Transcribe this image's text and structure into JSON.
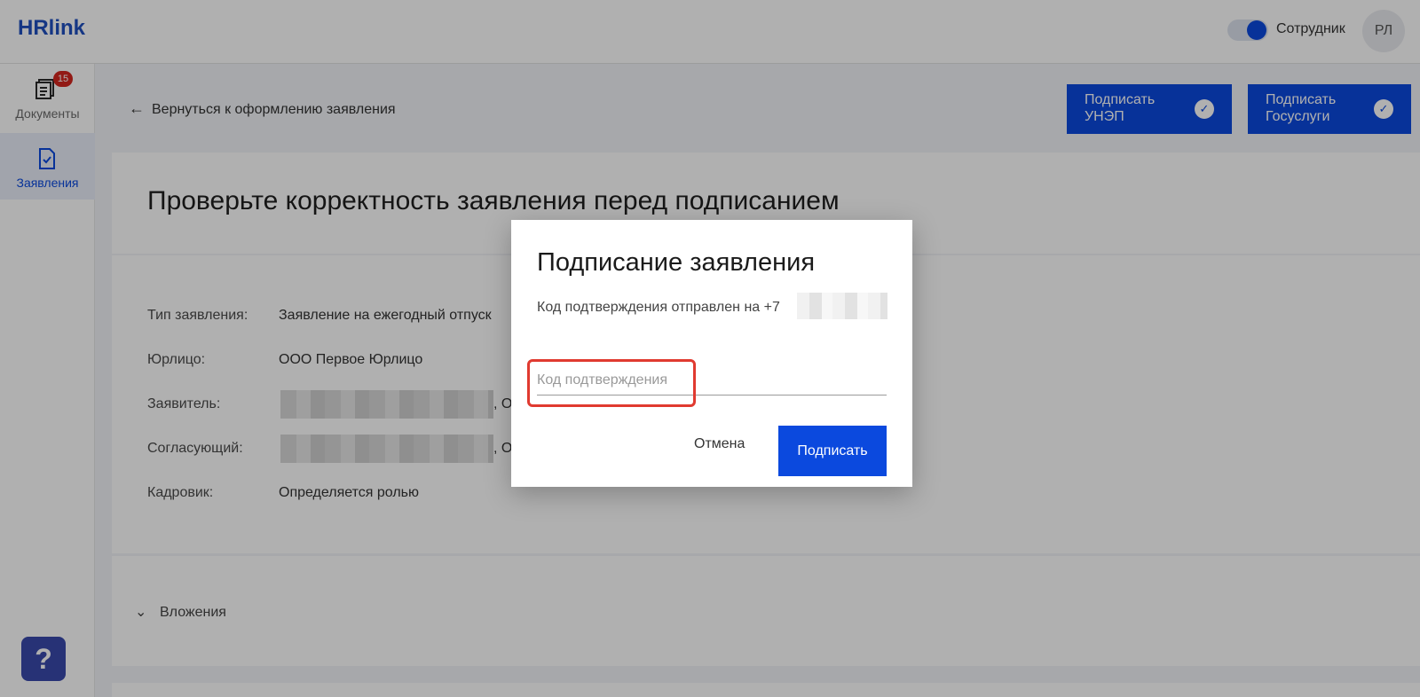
{
  "header": {
    "logo_text": "HRlink",
    "role_toggle_label": "Сотрудник",
    "avatar_initials": "РЛ"
  },
  "sidebar": {
    "items": [
      {
        "label": "Документы",
        "badge": "15"
      },
      {
        "label": "Заявления"
      }
    ],
    "help_label": "?"
  },
  "page": {
    "back_link": "Вернуться к оформлению заявления",
    "sign_unep_label": "Подписать УНЭП",
    "sign_gosuslugi_label": "Подписать Госуслуги",
    "title": "Проверьте корректность заявления перед подписанием",
    "details": [
      {
        "label": "Тип заявления:",
        "value": "Заявление на ежегодный отпуск"
      },
      {
        "label": "Юрлицо:",
        "value": "ООО Первое Юрлицо"
      },
      {
        "label": "Заявитель:",
        "value": ", О"
      },
      {
        "label": "Согласующий:",
        "value": ", О"
      },
      {
        "label": "Кадровик:",
        "value": "Определяется ролью"
      }
    ],
    "attachments_label": "Вложения"
  },
  "modal": {
    "title": "Подписание заявления",
    "subtitle": "Код подтверждения отправлен на +7",
    "input_placeholder": "Код подтверждения",
    "input_value": "",
    "cancel_label": "Отмена",
    "sign_label": "Подписать"
  },
  "colors": {
    "brand_blue": "#0b49de",
    "badge_red": "#d4271f",
    "highlight_red": "#e03a30"
  }
}
